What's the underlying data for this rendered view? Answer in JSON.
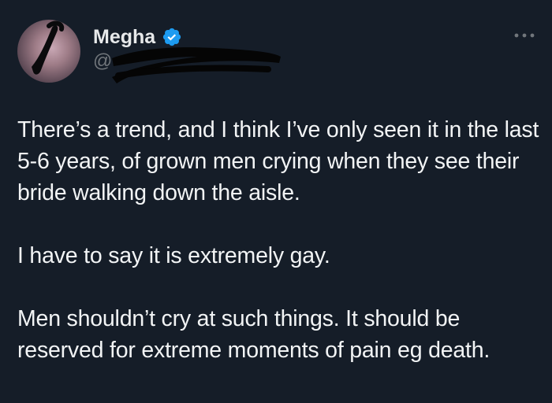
{
  "colors": {
    "background": "#151d28",
    "text_primary": "#e7e9ea",
    "text_secondary": "#71767b",
    "verified_badge": "#1d9bf0"
  },
  "author": {
    "name": "Megha",
    "handle": "@",
    "verified": true,
    "avatar_icon": "avatar-image"
  },
  "header": {
    "more_icon": "more-horizontal-icon"
  },
  "tweet": {
    "paragraphs": [
      "There’s a trend, and I think I’ve only seen it in the last 5-6 years, of grown men crying when they see their bride walking down the aisle.",
      "I have to say it is extremely gay.",
      "Men shouldn’t cry at such things. It should be reserved for extreme moments of pain eg death."
    ]
  }
}
